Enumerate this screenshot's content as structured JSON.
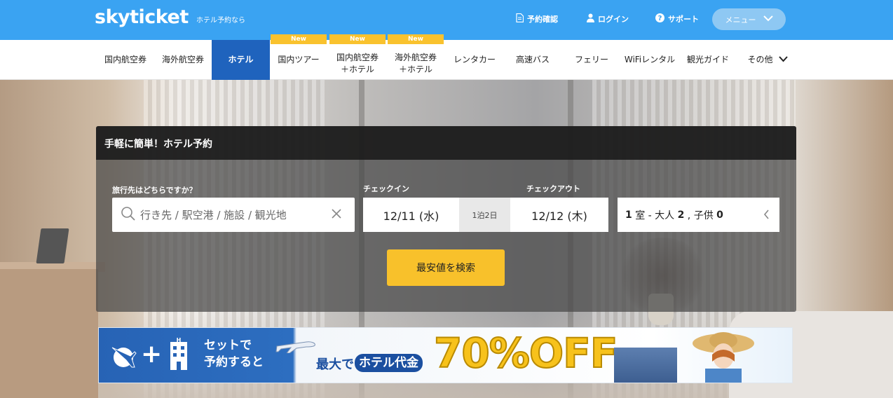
{
  "header": {
    "logo": "skyticket",
    "tagline": "ホテル予約なら",
    "links": {
      "reservation_check": "予約確認",
      "login": "ログイン",
      "support": "サポート"
    },
    "menu_label": "メニュー"
  },
  "nav": {
    "badge": "New",
    "items": {
      "domestic_air": "国内航空券",
      "overseas_air": "海外航空券",
      "hotel": "ホテル",
      "domestic_tour": "国内ツアー",
      "domestic_air_hotel_1": "国内航空券",
      "domestic_air_hotel_2": "＋ホテル",
      "overseas_air_hotel_1": "海外航空券",
      "overseas_air_hotel_2": "＋ホテル",
      "rental_car": "レンタカー",
      "highway_bus": "高速バス",
      "ferry": "フェリー",
      "wifi": "WiFiレンタル",
      "guide": "観光ガイド",
      "other": "その他"
    }
  },
  "search": {
    "title": "手軽に簡単！ホテル予約",
    "destination_label": "旅行先はどちらですか？",
    "destination_placeholder": "行き先 / 駅空港 / 施設 / 観光地",
    "checkin_label": "チェックイン",
    "checkout_label": "チェックアウト",
    "checkin_value": "12/11 (水)",
    "nights": "1泊2日",
    "checkout_value": "12/12 (木)",
    "guests": {
      "rooms": "1",
      "rooms_unit": " 室 - 大人 ",
      "adults": "2",
      "children_label": " , 子供 ",
      "children": "0"
    },
    "button": "最安値を検索"
  },
  "banner": {
    "plus": "+",
    "set_line1": "セットで",
    "set_line2": "予約すると",
    "max": "最大で",
    "hotel_price": "ホテル代金",
    "discount": "70%OFF"
  },
  "colors": {
    "header_bg": "#3aa3f2",
    "nav_active": "#1f63bd",
    "badge": "#f9c22e",
    "search_button": "#f8c12b"
  }
}
